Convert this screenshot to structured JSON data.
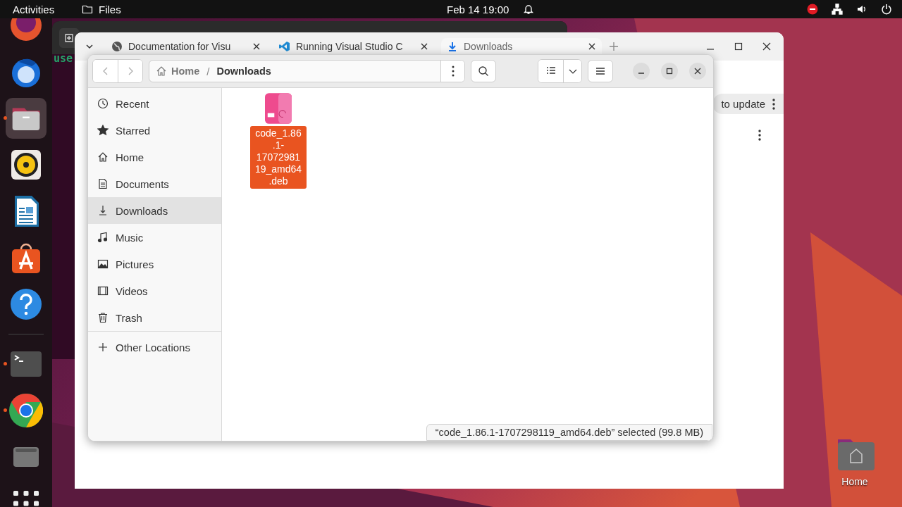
{
  "top_bar": {
    "activities": "Activities",
    "app_name": "Files",
    "clock": "Feb 14  19:00"
  },
  "dock": [
    {
      "kind": "firefox",
      "running": false
    },
    {
      "kind": "mail",
      "running": false
    },
    {
      "kind": "files",
      "running": true
    },
    {
      "kind": "music",
      "running": false
    },
    {
      "kind": "writer",
      "running": false
    },
    {
      "kind": "store",
      "running": false
    },
    {
      "kind": "help",
      "running": false
    },
    {
      "kind": "terminal",
      "running": true
    },
    {
      "kind": "chrome",
      "running": true
    },
    {
      "kind": "drive",
      "running": false
    },
    {
      "kind": "apps",
      "running": false
    }
  ],
  "terminal": {
    "prompt": "use"
  },
  "browser": {
    "tabs": [
      {
        "label": "Documentation for Visu",
        "kind": "globe",
        "selected": false
      },
      {
        "label": "Running Visual Studio C",
        "kind": "vscode",
        "selected": false
      },
      {
        "label": "Downloads",
        "kind": "download",
        "selected": true
      }
    ],
    "update_button": "to update"
  },
  "files": {
    "path_bar": {
      "items": [
        {
          "label": "Home",
          "kind": "home"
        },
        {
          "label": "Downloads",
          "kind": "folder"
        }
      ],
      "separator": "/"
    },
    "sidebar": [
      {
        "label": "Recent",
        "kind": "recent",
        "selected": false
      },
      {
        "label": "Starred",
        "kind": "star",
        "selected": false
      },
      {
        "label": "Home",
        "kind": "home",
        "selected": false
      },
      {
        "label": "Documents",
        "kind": "document",
        "selected": false
      },
      {
        "label": "Downloads",
        "kind": "download",
        "selected": true
      },
      {
        "label": "Music",
        "kind": "music",
        "selected": false
      },
      {
        "label": "Pictures",
        "kind": "picture",
        "selected": false
      },
      {
        "label": "Videos",
        "kind": "video",
        "selected": false
      },
      {
        "label": "Trash",
        "kind": "trash",
        "selected": false
      }
    ],
    "other_locations": "Other Locations",
    "items": [
      {
        "name": "code_1.86.1-1707298119_amd64.deb",
        "selected": true
      }
    ],
    "status": "“code_1.86.1-1707298119_amd64.deb” selected  (99.8 MB)"
  },
  "desktop_icons": [
    {
      "label": "Home"
    }
  ]
}
